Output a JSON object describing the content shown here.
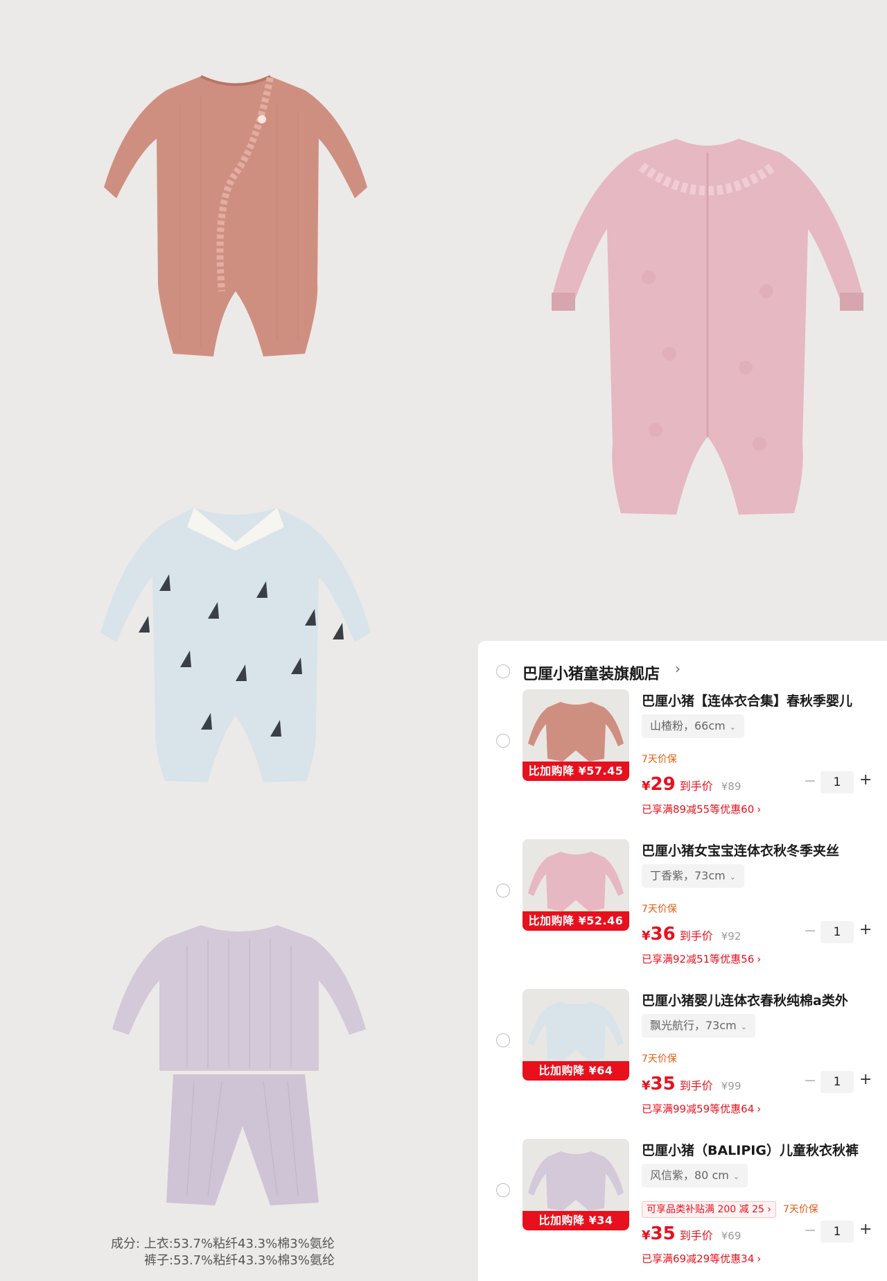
{
  "composition": {
    "label": "成分:",
    "top": "上衣:53.7%粘纤43.3%棉3%氨纶",
    "bottom": "裤子:53.7%粘纤43.3%棉3%氨纶"
  },
  "cart": {
    "store_name": "巴厘小猪童装旗舰店",
    "store_arrow": "›",
    "items": [
      {
        "title": "巴厘小猪【连体衣合集】春秋季婴儿",
        "variant": "山楂粉，66cm",
        "badge": "比加购降 ¥57.45",
        "subsidy": "",
        "guarantee": "7天价保",
        "price_symbol": "¥",
        "price": "29",
        "price_label": "到手价",
        "original_price": "¥89",
        "quantity": "1",
        "promo": "已享满89减55等优惠60",
        "thumb_color": "#cf8f80"
      },
      {
        "title": "巴厘小猪女宝宝连体衣秋冬季夹丝",
        "variant": "丁香紫，73cm",
        "badge": "比加购降 ¥52.46",
        "subsidy": "",
        "guarantee": "7天价保",
        "price_symbol": "¥",
        "price": "36",
        "price_label": "到手价",
        "original_price": "¥92",
        "quantity": "1",
        "promo": "已享满92减51等优惠56",
        "thumb_color": "#e6b8c2"
      },
      {
        "title": "巴厘小猪婴儿连体衣春秋纯棉a类外",
        "variant": "飘光航行，73cm",
        "badge": "比加购降 ¥64",
        "subsidy": "",
        "guarantee": "7天价保",
        "price_symbol": "¥",
        "price": "35",
        "price_label": "到手价",
        "original_price": "¥99",
        "quantity": "1",
        "promo": "已享满99减59等优惠64",
        "thumb_color": "#d9e3ea"
      },
      {
        "title": "巴厘小猪（BALIPIG）儿童秋衣秋裤",
        "variant": "风信紫，80 cm",
        "badge": "比加购降 ¥34",
        "subsidy": "可享品类补贴满 200 减 25 ›",
        "guarantee": "7天价保",
        "price_symbol": "¥",
        "price": "35",
        "price_label": "到手价",
        "original_price": "¥69",
        "quantity": "1",
        "promo": "已享满69减29等优惠34",
        "thumb_color": "#d3c9d8"
      }
    ],
    "minus_symbol": "−",
    "plus_symbol": "+",
    "chevron": "⌄",
    "promo_arrow": "›"
  },
  "colors": {
    "background": "#ebeae8",
    "accent_red": "#e8101d",
    "guarantee_orange": "#e65a0f"
  }
}
